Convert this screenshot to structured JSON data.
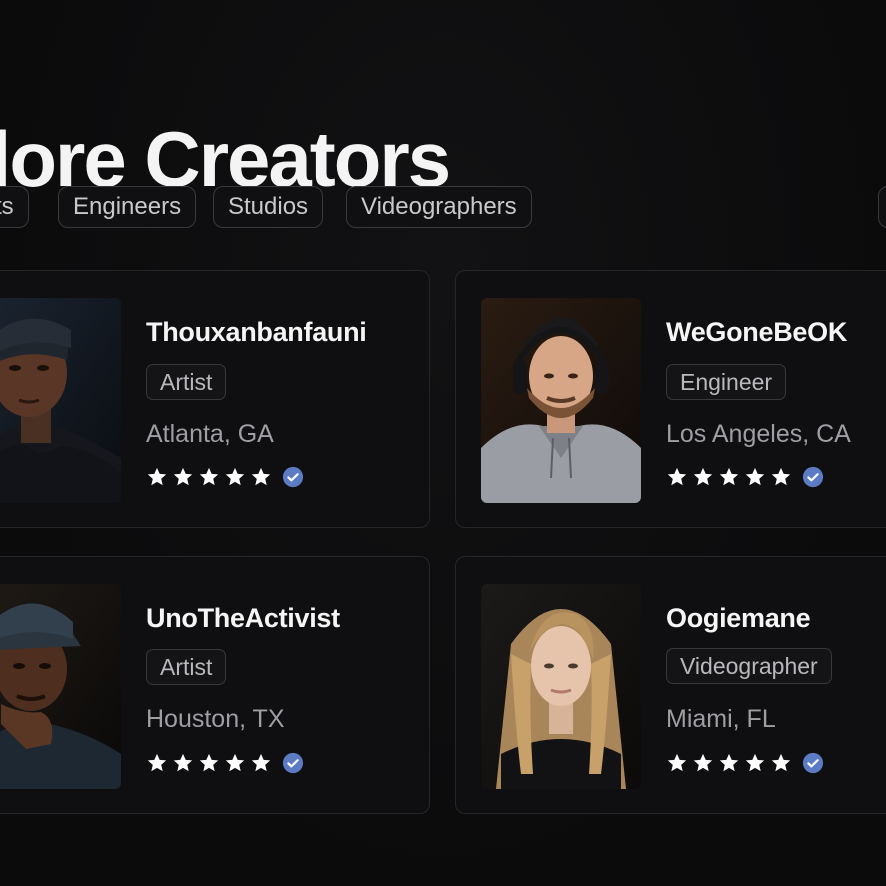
{
  "header": {
    "title": "plore Creators"
  },
  "filters": [
    {
      "label": "ts"
    },
    {
      "label": "Engineers"
    },
    {
      "label": "Studios"
    },
    {
      "label": "Videographers"
    }
  ],
  "creators": [
    {
      "name": "Thouxanbanfauni",
      "role": "Artist",
      "location": "Atlanta, GA",
      "rating": 5,
      "verified": true
    },
    {
      "name": "WeGoneBeOK",
      "role": "Engineer",
      "location": "Los Angeles, CA",
      "rating": 5,
      "verified": true
    },
    {
      "name": "UnoTheActivist",
      "role": "Artist",
      "location": "Houston, TX",
      "rating": 5,
      "verified": true
    },
    {
      "name": "Oogiemane",
      "role": "Videographer",
      "location": "Miami, FL",
      "rating": 5,
      "verified": true
    }
  ],
  "colors": {
    "background": "#0b0b0c",
    "card": "#0f0f11",
    "star": "#ffffff",
    "verified": "#5b7cc4"
  },
  "icons": {
    "star": "star-icon",
    "verified": "verified-check-icon"
  }
}
